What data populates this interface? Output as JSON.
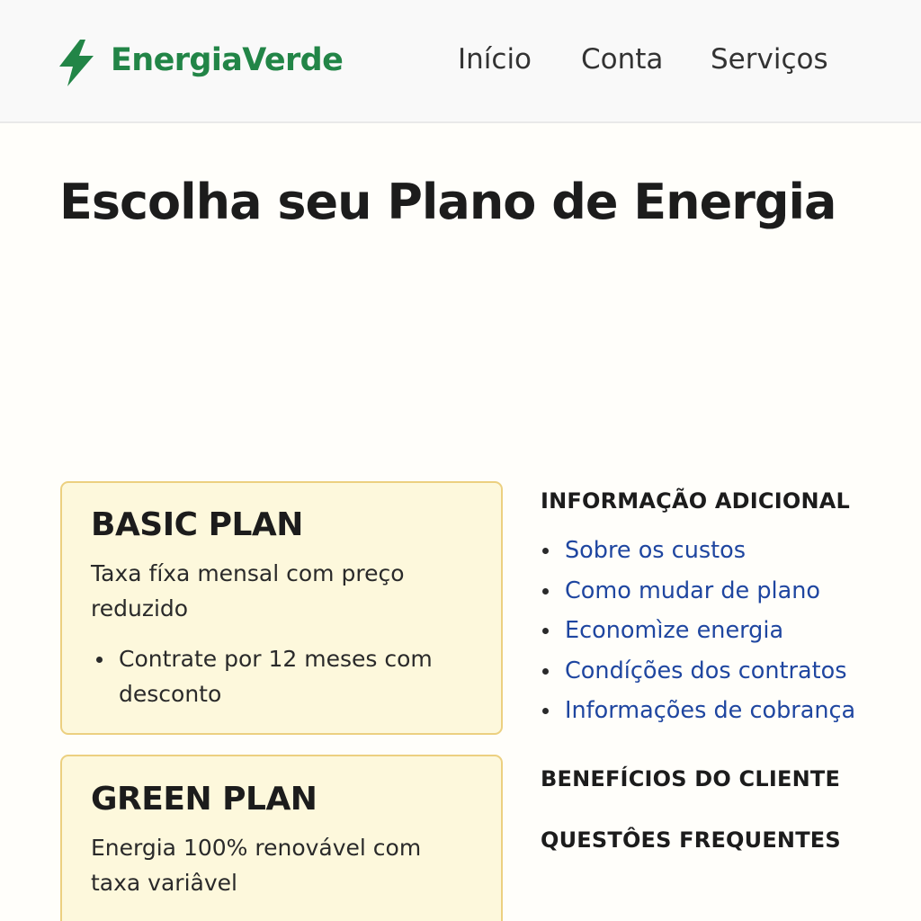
{
  "header": {
    "brand": "EnergiaVerde",
    "brand_icon": "lightning-bolt-icon",
    "brand_color": "#228547",
    "nav": [
      "Início",
      "Conta",
      "Serviços"
    ]
  },
  "main": {
    "title": "Escolha seu Plano de Energia",
    "plans": [
      {
        "name": "BASIC PLAN",
        "description": "Taxa fíxa mensal com preço reduzido",
        "bullets": [
          "Contrate por 12 meses com desconto"
        ]
      },
      {
        "name": "GREEN PLAN",
        "description": "Energia 100% renovável com taxa variâvel",
        "bullets": []
      }
    ]
  },
  "sidebar": {
    "info_heading": "INFORMAÇÃO ADICIONAL",
    "links": [
      "Sobre os custos",
      "Como mudar de plano",
      "Economìze energia",
      "Condíções dos contratos",
      "Informações de cobrança"
    ],
    "benefits_heading": "BENEFÍCIOS DO CLIENTE",
    "faq_heading": "QUESTÔES FREQUENTES"
  },
  "colors": {
    "card_background": "#fdf8dc",
    "card_border": "#ecd080",
    "link": "#1f46a0"
  }
}
